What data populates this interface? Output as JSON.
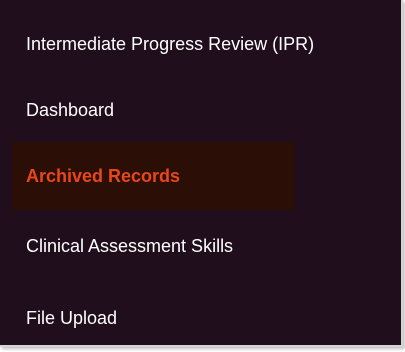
{
  "menu": {
    "items": [
      {
        "label": "Intermediate Progress Review (IPR)",
        "active": false
      },
      {
        "label": "Dashboard",
        "active": false
      },
      {
        "label": "Archived Records",
        "active": true
      },
      {
        "label": "Clinical Assessment Skills",
        "active": false
      },
      {
        "label": "File Upload",
        "active": false
      }
    ]
  },
  "colors": {
    "panel_background": "#210e1c",
    "active_background": "#2b0f07",
    "active_text": "#e8471a",
    "text": "#ffffff"
  }
}
